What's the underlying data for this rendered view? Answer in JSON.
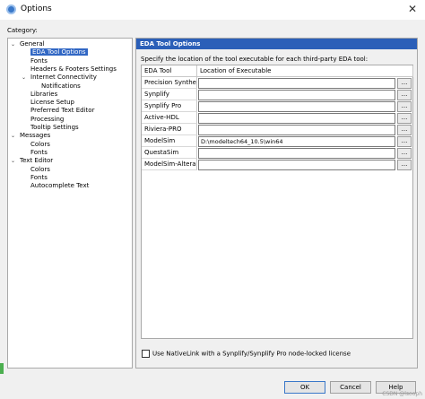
{
  "window": {
    "title": "Options",
    "close_glyph": "✕"
  },
  "category_label": "Category:",
  "tree": [
    {
      "label": "General",
      "indent": 1,
      "toggle": "⌄"
    },
    {
      "label": "EDA Tool Options",
      "indent": 2,
      "selected": true
    },
    {
      "label": "Fonts",
      "indent": 2
    },
    {
      "label": "Headers & Footers Settings",
      "indent": 2
    },
    {
      "label": "Internet Connectivity",
      "indent": 2,
      "toggle": "⌄"
    },
    {
      "label": "Notifications",
      "indent": 3
    },
    {
      "label": "Libraries",
      "indent": 2
    },
    {
      "label": "License Setup",
      "indent": 2
    },
    {
      "label": "Preferred Text Editor",
      "indent": 2
    },
    {
      "label": "Processing",
      "indent": 2
    },
    {
      "label": "Tooltip Settings",
      "indent": 2
    },
    {
      "label": "Messages",
      "indent": 1,
      "toggle": "⌄"
    },
    {
      "label": "Colors",
      "indent": 2
    },
    {
      "label": "Fonts",
      "indent": 2
    },
    {
      "label": "Text Editor",
      "indent": 1,
      "toggle": "⌄"
    },
    {
      "label": "Colors",
      "indent": 2
    },
    {
      "label": "Fonts",
      "indent": 2
    },
    {
      "label": "Autocomplete Text",
      "indent": 2
    }
  ],
  "panel": {
    "header": "EDA Tool Options",
    "description": "Specify the location of the tool executable for each third-party EDA tool:",
    "columns": [
      "EDA Tool",
      "Location of Executable"
    ],
    "rows": [
      {
        "tool": "Precision Synthesis",
        "location": ""
      },
      {
        "tool": "Synplify",
        "location": ""
      },
      {
        "tool": "Synplify Pro",
        "location": ""
      },
      {
        "tool": "Active-HDL",
        "location": ""
      },
      {
        "tool": "Riviera-PRO",
        "location": ""
      },
      {
        "tool": "ModelSim",
        "location": "D:\\modeltech64_10.5\\win64"
      },
      {
        "tool": "QuestaSim",
        "location": ""
      },
      {
        "tool": "ModelSim-Altera",
        "location": ""
      }
    ],
    "browse_label": "...",
    "checkbox_label": "Use NativeLink with a Synplify/Synplify Pro node-locked license",
    "checkbox_checked": false
  },
  "buttons": {
    "ok": "OK",
    "cancel": "Cancel",
    "help": "Help"
  },
  "watermark": "CSDN @lsooph"
}
